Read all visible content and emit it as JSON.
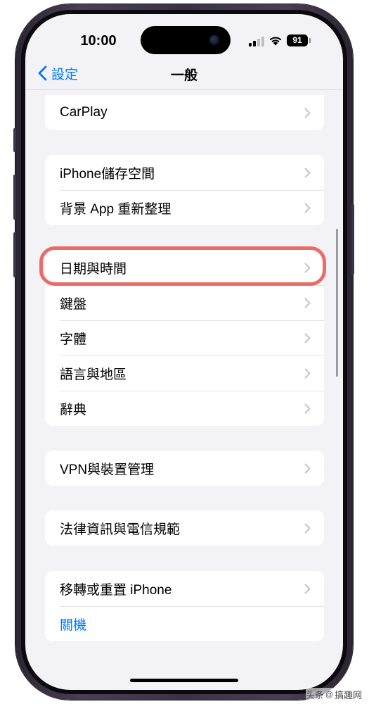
{
  "status_bar": {
    "time": "10:00",
    "battery": "91",
    "icons": [
      "signal-icon",
      "wifi-icon",
      "battery-icon"
    ]
  },
  "nav": {
    "back_label": "設定",
    "title": "一般",
    "back_icon": "chevron-left-icon"
  },
  "groups": [
    {
      "items": [
        {
          "label": "CarPlay"
        }
      ]
    },
    {
      "items": [
        {
          "label": "iPhone儲存空間"
        },
        {
          "label": "背景 App 重新整理"
        }
      ]
    },
    {
      "items": [
        {
          "label": "日期與時間"
        },
        {
          "label": "鍵盤"
        },
        {
          "label": "字體"
        },
        {
          "label": "語言與地區"
        },
        {
          "label": "辭典"
        }
      ]
    },
    {
      "items": [
        {
          "label": "VPN與裝置管理"
        }
      ]
    },
    {
      "items": [
        {
          "label": "法律資訊與電信規範"
        }
      ]
    },
    {
      "items": [
        {
          "label": "移轉或重置 iPhone"
        },
        {
          "label": "關機"
        }
      ]
    }
  ],
  "highlighted_item": "日期與時間",
  "watermark": {
    "prefix": "头条",
    "at": "@",
    "name": "搞趣网"
  },
  "colors": {
    "accent": "#007aff",
    "highlight": "#ec6b66",
    "background": "#f2f2f7",
    "chevron": "#c4c4c9"
  }
}
